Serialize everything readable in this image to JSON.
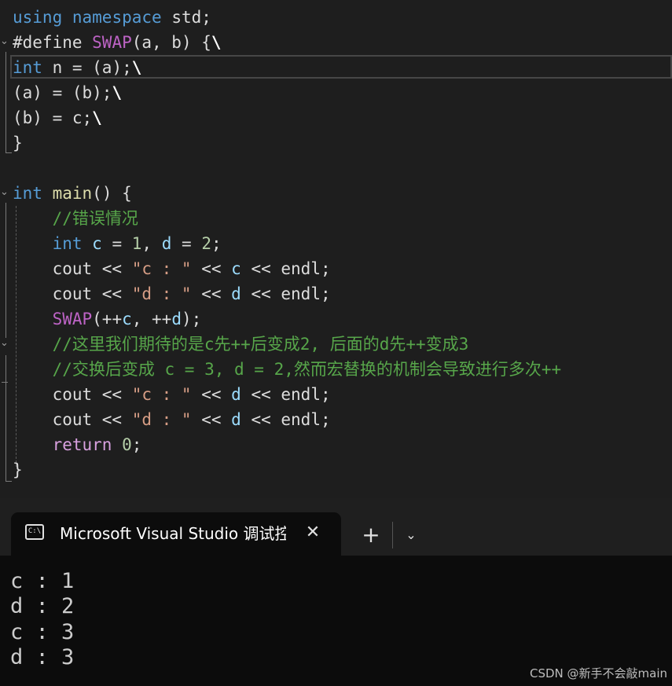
{
  "editor": {
    "lines": [
      {
        "segments": [
          {
            "t": "using",
            "c": "kw"
          },
          {
            "t": " ",
            "c": "ident"
          },
          {
            "t": "namespace",
            "c": "kw"
          },
          {
            "t": " std;",
            "c": "ident"
          }
        ]
      },
      {
        "segments": [
          {
            "t": "#define ",
            "c": "ident"
          },
          {
            "t": "SWAP",
            "c": "macro"
          },
          {
            "t": "(a, b) {",
            "c": "ident"
          },
          {
            "t": "\\",
            "c": "bs"
          }
        ]
      },
      {
        "segments": [
          {
            "t": "int",
            "c": "kw"
          },
          {
            "t": " n = (a);",
            "c": "ident"
          },
          {
            "t": "\\",
            "c": "bs"
          }
        ]
      },
      {
        "segments": [
          {
            "t": "(a) = (b);",
            "c": "ident"
          },
          {
            "t": "\\",
            "c": "bs"
          }
        ]
      },
      {
        "segments": [
          {
            "t": "(b) = c;",
            "c": "ident"
          },
          {
            "t": "\\",
            "c": "bs"
          }
        ]
      },
      {
        "segments": [
          {
            "t": "}",
            "c": "ident"
          }
        ]
      },
      {
        "segments": []
      },
      {
        "segments": [
          {
            "t": "int",
            "c": "kw"
          },
          {
            "t": " ",
            "c": "ident"
          },
          {
            "t": "main",
            "c": "fn"
          },
          {
            "t": "() {",
            "c": "ident"
          }
        ]
      },
      {
        "segments": [
          {
            "t": "    ",
            "c": "ident"
          },
          {
            "t": "//错误情况",
            "c": "cmt"
          }
        ]
      },
      {
        "segments": [
          {
            "t": "    ",
            "c": "ident"
          },
          {
            "t": "int",
            "c": "kw"
          },
          {
            "t": " ",
            "c": "ident"
          },
          {
            "t": "c",
            "c": "var"
          },
          {
            "t": " = ",
            "c": "ident"
          },
          {
            "t": "1",
            "c": "num"
          },
          {
            "t": ", ",
            "c": "ident"
          },
          {
            "t": "d",
            "c": "var"
          },
          {
            "t": " = ",
            "c": "ident"
          },
          {
            "t": "2",
            "c": "num"
          },
          {
            "t": ";",
            "c": "ident"
          }
        ]
      },
      {
        "segments": [
          {
            "t": "    cout << ",
            "c": "ident"
          },
          {
            "t": "\"c : \"",
            "c": "str"
          },
          {
            "t": " << ",
            "c": "ident"
          },
          {
            "t": "c",
            "c": "var"
          },
          {
            "t": " << endl;",
            "c": "ident"
          }
        ]
      },
      {
        "segments": [
          {
            "t": "    cout << ",
            "c": "ident"
          },
          {
            "t": "\"d : \"",
            "c": "str"
          },
          {
            "t": " << ",
            "c": "ident"
          },
          {
            "t": "d",
            "c": "var"
          },
          {
            "t": " << endl;",
            "c": "ident"
          }
        ]
      },
      {
        "segments": [
          {
            "t": "    ",
            "c": "ident"
          },
          {
            "t": "SWAP",
            "c": "macro"
          },
          {
            "t": "(++",
            "c": "ident"
          },
          {
            "t": "c",
            "c": "var"
          },
          {
            "t": ", ++",
            "c": "ident"
          },
          {
            "t": "d",
            "c": "var"
          },
          {
            "t": ");",
            "c": "ident"
          }
        ]
      },
      {
        "segments": [
          {
            "t": "    ",
            "c": "ident"
          },
          {
            "t": "//这里我们期待的是c先++后变成2, 后面的d先++变成3",
            "c": "cmt"
          }
        ]
      },
      {
        "segments": [
          {
            "t": "    ",
            "c": "ident"
          },
          {
            "t": "//交换后变成 c = 3, d = 2,然而宏替换的机制会导致进行多次++",
            "c": "cmt"
          }
        ]
      },
      {
        "segments": [
          {
            "t": "    cout << ",
            "c": "ident"
          },
          {
            "t": "\"c : \"",
            "c": "str"
          },
          {
            "t": " << ",
            "c": "ident"
          },
          {
            "t": "d",
            "c": "var"
          },
          {
            "t": " << endl;",
            "c": "ident"
          }
        ]
      },
      {
        "segments": [
          {
            "t": "    cout << ",
            "c": "ident"
          },
          {
            "t": "\"d : \"",
            "c": "str"
          },
          {
            "t": " << ",
            "c": "ident"
          },
          {
            "t": "d",
            "c": "var"
          },
          {
            "t": " << endl;",
            "c": "ident"
          }
        ]
      },
      {
        "segments": [
          {
            "t": "    ",
            "c": "ident"
          },
          {
            "t": "return",
            "c": "ret"
          },
          {
            "t": " ",
            "c": "ident"
          },
          {
            "t": "0",
            "c": "num"
          },
          {
            "t": ";",
            "c": "ident"
          }
        ]
      },
      {
        "segments": [
          {
            "t": "}",
            "c": "ident"
          }
        ]
      }
    ]
  },
  "terminal": {
    "tab_title": "Microsoft Visual Studio 调试控制台",
    "tab_icon_label": "C:\\",
    "close_glyph": "✕",
    "new_tab_glyph": "+",
    "dropdown_glyph": "⌄",
    "output": [
      "c : 1",
      "d : 2",
      "c : 3",
      "d : 3"
    ]
  },
  "watermark": "CSDN @新手不会敲main"
}
